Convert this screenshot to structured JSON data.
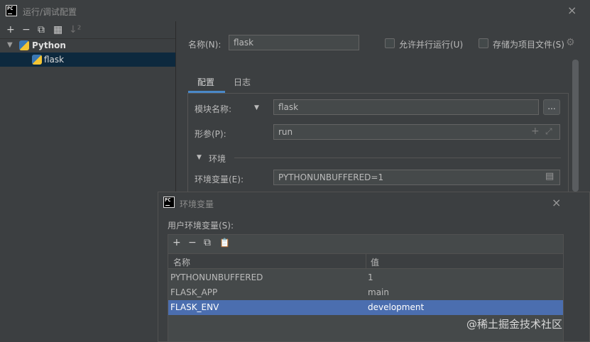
{
  "window": {
    "title": "运行/调试配置",
    "close_icon": "×"
  },
  "left_toolbar": {
    "add": "+",
    "remove": "−",
    "copy": "⧉",
    "folder": "▦",
    "sort": "↓²"
  },
  "tree": {
    "group_label": "Python",
    "item_label": "flask"
  },
  "config": {
    "name_label": "名称(N):",
    "name_value": "flask",
    "allow_parallel_label": "允许并行运行(U)",
    "store_as_project_label": "存储为项目文件(S)",
    "tabs": [
      {
        "label": "配置"
      },
      {
        "label": "日志"
      }
    ],
    "module_label": "模块名称:",
    "module_value": "flask",
    "browse_button": "...",
    "params_label": "形参(P):",
    "params_value": "run",
    "env_section_label": "环境",
    "env_vars_label": "环境变量(E):",
    "env_vars_value": "PYTHONUNBUFFERED=1"
  },
  "env_dialog": {
    "title": "环境变量",
    "close_icon": "×",
    "user_vars_label": "用户环境变量(S):",
    "toolbar": {
      "add": "+",
      "remove": "−",
      "copy": "⧉",
      "paste": "📋"
    },
    "columns": [
      "名称",
      "值"
    ],
    "rows": [
      {
        "name": "PYTHONUNBUFFERED",
        "value": "1"
      },
      {
        "name": "FLASK_APP",
        "value": "main"
      },
      {
        "name": "FLASK_ENV",
        "value": "development"
      }
    ],
    "selected_row": 2
  },
  "watermark": "@稀土掘金技术社区",
  "colors": {
    "accent": "#4a88c7",
    "selection": "#4b6eaf",
    "panel": "#3c3f41",
    "input_bg": "#45494a"
  }
}
